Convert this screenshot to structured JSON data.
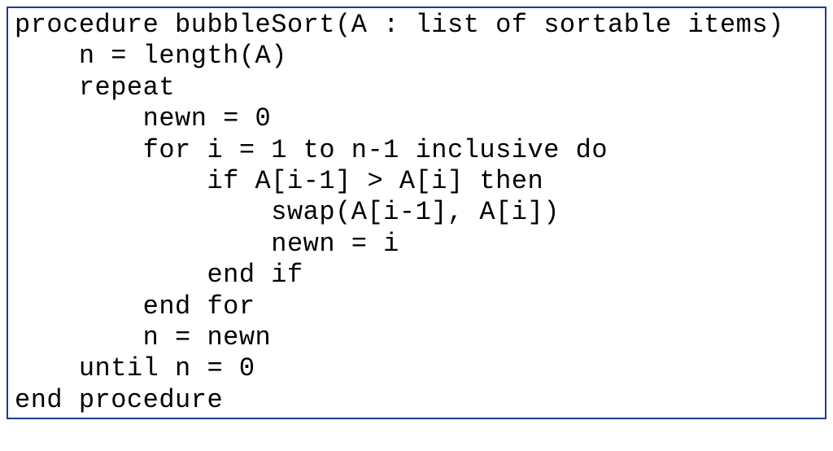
{
  "pseudocode": {
    "lines": [
      "procedure bubbleSort(A : list of sortable items)",
      "    n = length(A)",
      "    repeat",
      "        newn = 0",
      "        for i = 1 to n-1 inclusive do",
      "            if A[i-1] > A[i] then",
      "                swap(A[i-1], A[i])",
      "                newn = i",
      "            end if",
      "        end for",
      "        n = newn",
      "    until n = 0",
      "end procedure"
    ]
  }
}
